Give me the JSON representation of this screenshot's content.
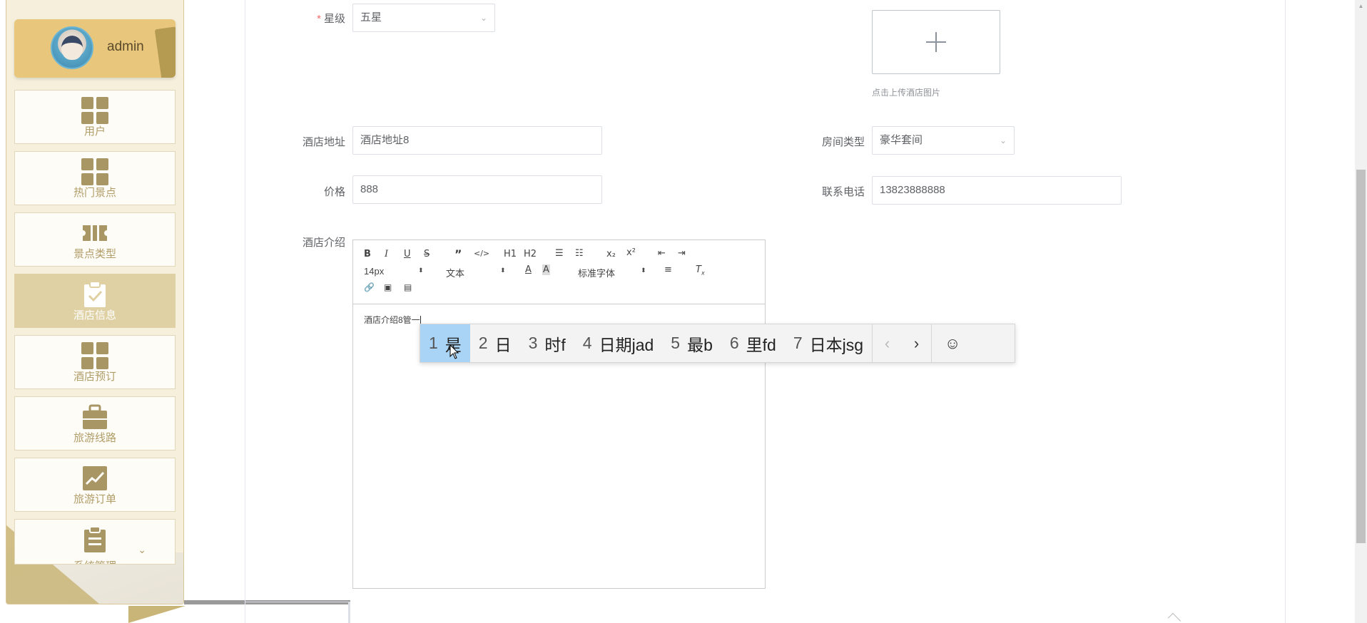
{
  "user": {
    "name": "admin"
  },
  "menu": [
    {
      "label": "用户",
      "icon": "grid-icon",
      "active": false
    },
    {
      "label": "热门景点",
      "icon": "grid-icon",
      "active": false
    },
    {
      "label": "景点类型",
      "icon": "ticket-icon",
      "active": false
    },
    {
      "label": "酒店信息",
      "icon": "clipboard-check-icon",
      "active": true
    },
    {
      "label": "酒店预订",
      "icon": "grid-icon",
      "active": false
    },
    {
      "label": "旅游线路",
      "icon": "briefcase-icon",
      "active": false
    },
    {
      "label": "旅游订单",
      "icon": "chart-icon",
      "active": false
    },
    {
      "label": "系统管理",
      "icon": "clipboard-list-icon",
      "active": false,
      "expandable": true
    }
  ],
  "form": {
    "star": {
      "label": "星级",
      "required": true,
      "value": "五星"
    },
    "image": {
      "tip": "点击上传酒店图片"
    },
    "address": {
      "label": "酒店地址",
      "value": "酒店地址8"
    },
    "room_type": {
      "label": "房间类型",
      "value": "豪华套间"
    },
    "price": {
      "label": "价格",
      "value": "888"
    },
    "phone": {
      "label": "联系电话",
      "value": "13823888888"
    },
    "intro": {
      "label": "酒店介绍",
      "content": "酒店介绍8管一"
    }
  },
  "editor_toolbar": {
    "size": "14px",
    "header": "文本",
    "font": "标准字体",
    "h1": "H1",
    "h2": "H2",
    "sub": "x₂",
    "sup": "x²"
  },
  "ime": {
    "candidates": [
      {
        "num": "1",
        "text": "是",
        "selected": true
      },
      {
        "num": "2",
        "text": "日",
        "selected": false
      },
      {
        "num": "3",
        "text": "时f",
        "selected": false
      },
      {
        "num": "4",
        "text": "日期jad",
        "selected": false
      },
      {
        "num": "5",
        "text": "最b",
        "selected": false
      },
      {
        "num": "6",
        "text": "里fd",
        "selected": false
      },
      {
        "num": "7",
        "text": "日本jsg",
        "selected": false
      }
    ],
    "prev_label": "‹",
    "next_label": "›",
    "emoji_label": "☺"
  },
  "colors": {
    "accent": "#e8c77c",
    "sidebar_bg": "#f5efdc",
    "menu_active": "#dfd1a4",
    "menu_text": "#b19d68",
    "ime_selected": "#aad4f5"
  }
}
